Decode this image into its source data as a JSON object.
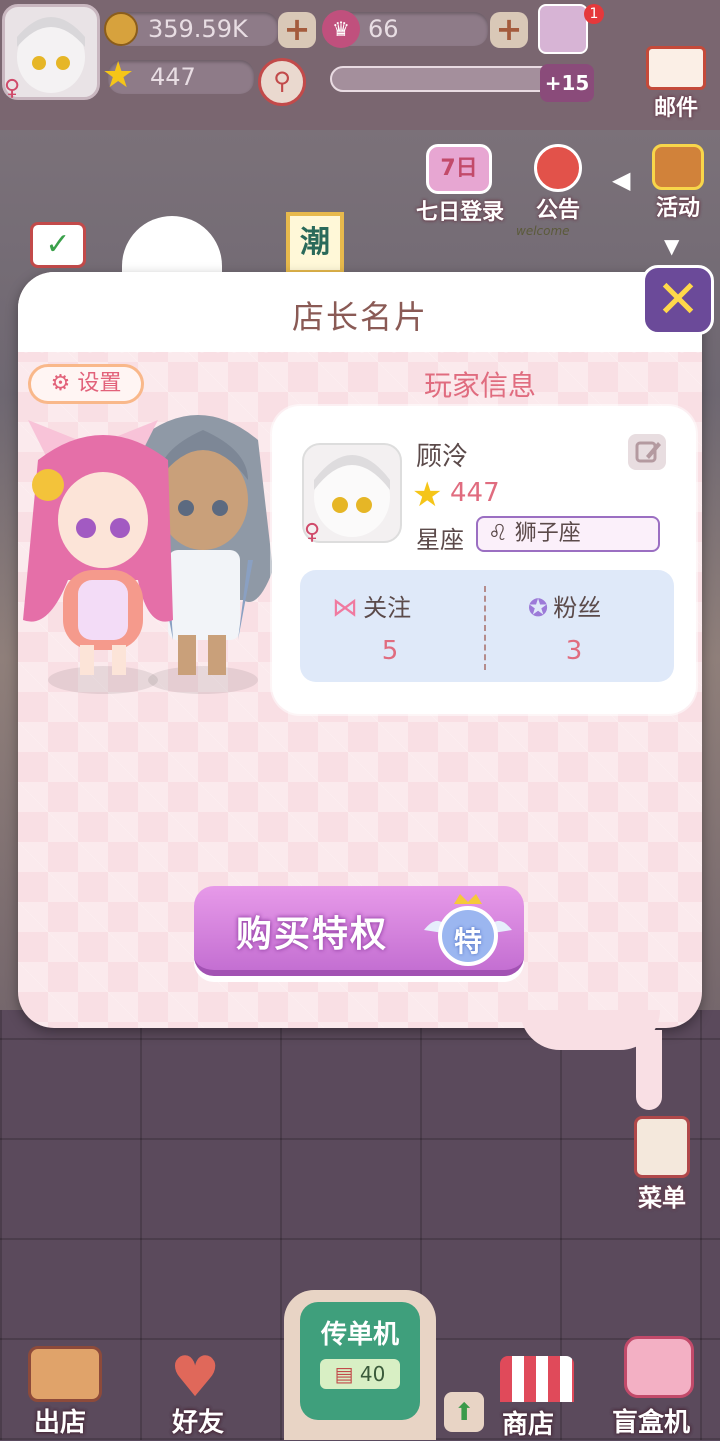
{
  "hud": {
    "coins": "359.59K",
    "gems": "66",
    "level": "447",
    "exp_bonus": "+15",
    "notification_count": "1",
    "mail_label": "邮件",
    "seven_day_label": "七日登录",
    "seven_day_badge": "7日",
    "announcement_label": "公告",
    "activity_label": "活动",
    "sign_label": "潮",
    "welcome_text": "welcome"
  },
  "modal": {
    "title": "店长名片",
    "settings_label": "设置",
    "section_title": "玩家信息",
    "player": {
      "name": "顾泠",
      "level": "447",
      "zodiac_label": "星座",
      "zodiac_symbol": "♌",
      "zodiac_value": "狮子座"
    },
    "social": {
      "follow_label": "关注",
      "follow_count": "5",
      "fans_label": "粉丝",
      "fans_count": "3"
    },
    "buy_button_label": "购买特权",
    "privilege_badge": "特",
    "close_symbol": "✕"
  },
  "side": {
    "menu_label": "菜单"
  },
  "bottom_nav": {
    "go_out": "出店",
    "friends": "好友",
    "flyer_machine": "传单机",
    "flyer_count": "40",
    "shop": "商店",
    "blind_box": "盲盒机"
  },
  "colors": {
    "accent_pink": "#e06c7f",
    "purple_button": "#c46fd2",
    "close_purple": "#6b4a99",
    "social_bg": "#dfe9f9"
  }
}
